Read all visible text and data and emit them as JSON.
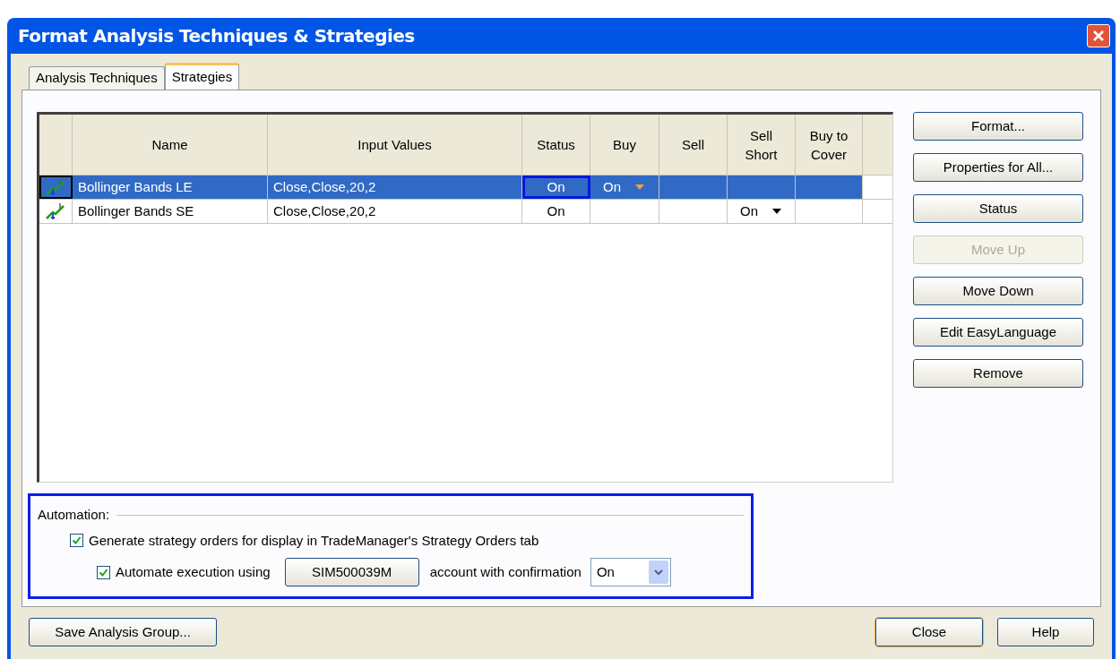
{
  "window": {
    "title": "Format Analysis Techniques & Strategies"
  },
  "tabs": [
    {
      "label": "Analysis Techniques",
      "selected": false
    },
    {
      "label": "Strategies",
      "selected": true
    }
  ],
  "table": {
    "columns": [
      "Name",
      "Input Values",
      "Status",
      "Buy",
      "Sell",
      "Sell\nShort",
      "Buy to\nCover"
    ],
    "rows": [
      {
        "selected": true,
        "name": "Bollinger Bands LE",
        "input_values": "Close,Close,20,2",
        "status": {
          "text": "On",
          "focused": true
        },
        "buy": {
          "text": "On",
          "dropdown": true
        }
      },
      {
        "selected": false,
        "name": "Bollinger Bands SE",
        "input_values": "Close,Close,20,2",
        "status": {
          "text": "On",
          "focused": false
        },
        "sell_short": {
          "text": "On",
          "dropdown": true
        }
      }
    ]
  },
  "side_buttons": [
    {
      "label": "Format...",
      "disabled": false
    },
    {
      "label": "Properties for All...",
      "disabled": false
    },
    {
      "label": "Status",
      "disabled": false
    },
    {
      "label": "Move Up",
      "disabled": true
    },
    {
      "label": "Move Down",
      "disabled": false
    },
    {
      "label": "Edit EasyLanguage",
      "disabled": false
    },
    {
      "label": "Remove",
      "disabled": false
    }
  ],
  "automation": {
    "label": "Automation:",
    "generate": {
      "label": "Generate strategy orders for display in TradeManager's Strategy Orders tab",
      "checked": true
    },
    "automate": {
      "label": "Automate execution using",
      "checked": true
    },
    "account_button": "SIM500039M",
    "confirmation_label": "account with confirmation",
    "confirmation": {
      "value": "On"
    }
  },
  "footer": {
    "save_button": "Save Analysis Group...",
    "close_button": "Close",
    "help_button": "Help"
  }
}
